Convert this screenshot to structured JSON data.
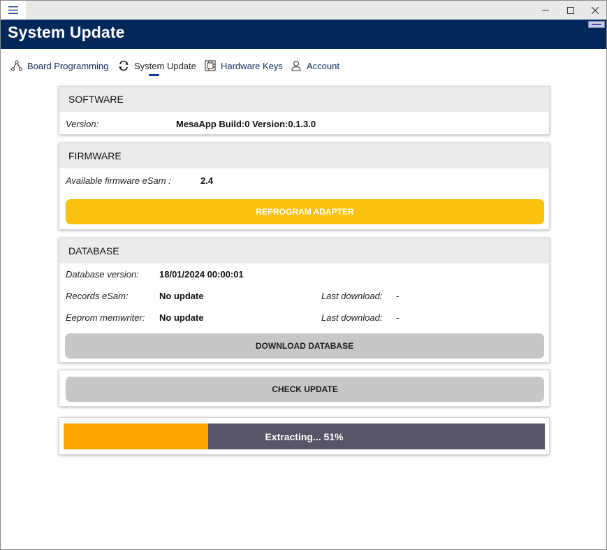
{
  "window": {
    "icons": {
      "menu": "hamburger-icon",
      "minimize": "minimize-icon",
      "maximize": "maximize-icon",
      "close": "close-icon"
    }
  },
  "header": {
    "title": "System Update",
    "accent_color": "#022859"
  },
  "nav": {
    "items": [
      {
        "label": "Board Programming",
        "icon": "network-icon"
      },
      {
        "label": "System Update",
        "icon": "sync-icon",
        "active": true
      },
      {
        "label": "Hardware Keys",
        "icon": "hardware-key-icon"
      },
      {
        "label": "Account",
        "icon": "user-icon"
      }
    ]
  },
  "software": {
    "title": "SOFTWARE",
    "version_label": "Version:",
    "version_value": "MesaApp Build:0 Version:0.1.3.0"
  },
  "firmware": {
    "title": "FIRMWARE",
    "available_label": "Available firmware eSam :",
    "available_value": "2.4",
    "button_label": "REPROGRAM ADAPTER",
    "button_color": "#fbc111"
  },
  "database": {
    "title": "DATABASE",
    "version_label": "Database version:",
    "version_value": "18/01/2024 00:00:01",
    "records_label": "Records eSam:",
    "records_value": "No update",
    "records_last_label": "Last download:",
    "records_last_value": "-",
    "eeprom_label": "Eeprom memwriter:",
    "eeprom_value": "No update",
    "eeprom_last_label": "Last download:",
    "eeprom_last_value": "-",
    "button_label": "DOWNLOAD DATABASE"
  },
  "update": {
    "button_label": "CHECK UPDATE"
  },
  "progress": {
    "text": "Extracting... 51%",
    "fill_fraction": 0.3,
    "fill_color": "#ffa500",
    "track_color": "#575466"
  }
}
